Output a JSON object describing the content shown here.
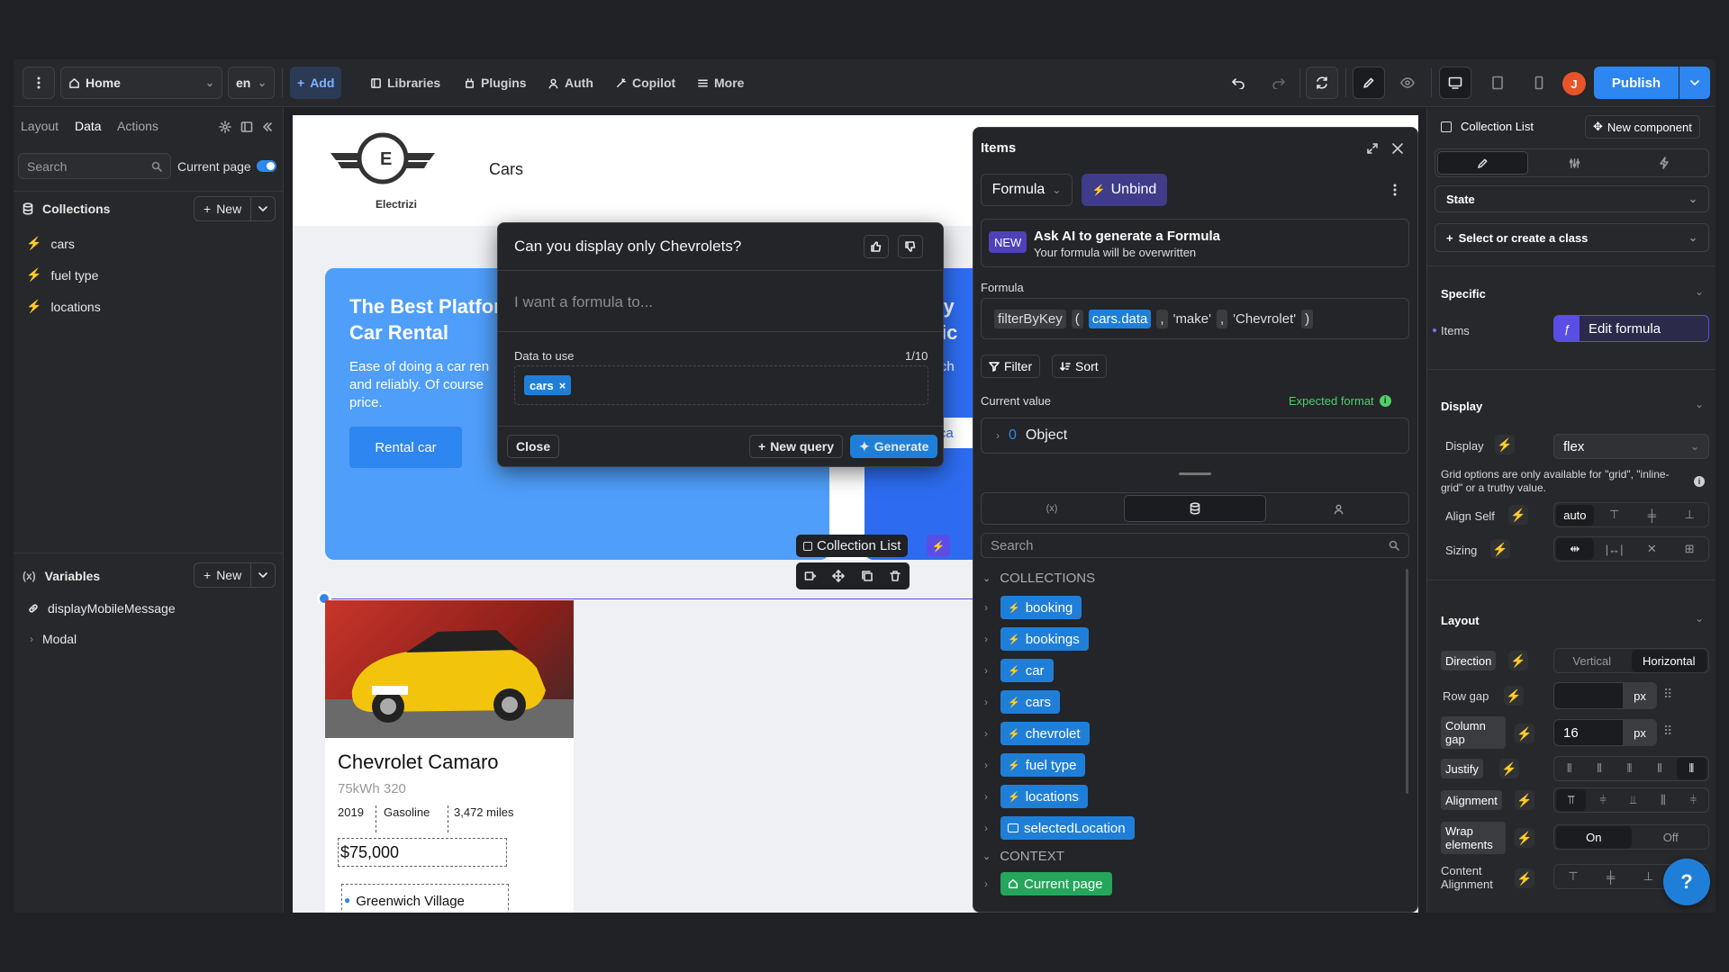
{
  "topbar": {
    "page_select": "Home",
    "lang_select": "en",
    "add": "Add",
    "libraries": "Libraries",
    "plugins": "Plugins",
    "auth": "Auth",
    "copilot": "Copilot",
    "more": "More",
    "avatar_initial": "J",
    "publish": "Publish"
  },
  "left": {
    "tabs": [
      "Layout",
      "Data",
      "Actions"
    ],
    "search_placeholder": "Search",
    "current_page_label": "Current page",
    "collections_title": "Collections",
    "new_label": "New",
    "collections": [
      "cars",
      "fuel type",
      "locations"
    ],
    "variables_title": "Variables",
    "variables": [
      "displayMobileMessage",
      "Modal"
    ]
  },
  "canvas": {
    "logo_letter": "E",
    "logo_text": "Electrizi",
    "page_heading": "Cars",
    "hero_title": "The Best Platfor Car Rental",
    "hero_title_l1": "The Best Platfor",
    "hero_title_l2": "Car Rental",
    "hero_body_l1": "Ease of doing a car ren",
    "hero_body_l2": "and reliably. Of course",
    "hero_body_l3": "price.",
    "hero_button": "Rental car",
    "hero2_l1": "vay",
    "hero2_l2": "oric",
    "hero2_l3": "ng ch",
    "hero2_l4": "and",
    "hero2_btn": "al ca",
    "collection_list_label": "Collection List",
    "card": {
      "title": "Chevrolet Camaro",
      "subtitle": "75kWh 320",
      "year": "2019",
      "fuel": "Gasoline",
      "miles": "3,472 miles",
      "price": "$75,000",
      "location": "Greenwich Village"
    }
  },
  "ai_popup": {
    "question": "Can you display only Chevrolets?",
    "placeholder": "I want a formula to...",
    "data_label": "Data to use",
    "count": "1/10",
    "chip": "cars",
    "close": "Close",
    "new_query": "New query",
    "generate": "Generate"
  },
  "items_panel": {
    "title": "Items",
    "formula_dropdown": "Formula",
    "unbind": "Unbind",
    "new_badge": "NEW",
    "ai_title": "Ask AI to generate a Formula",
    "ai_sub": "Your formula will be overwritten",
    "formula_label": "Formula",
    "formula": {
      "fn": "filterByKey",
      "open": "(",
      "arg1": "cars.data",
      "comma": ",",
      "arg2": "'make'",
      "arg3": "'Chevrolet'",
      "close": ")"
    },
    "filter": "Filter",
    "sort": "Sort",
    "current_value": "Current value",
    "expected_format": "Expected format",
    "value_index": "0",
    "value_type": "Object",
    "search_placeholder": "Search",
    "collections_header": "COLLECTIONS",
    "collections": [
      "booking",
      "bookings",
      "car",
      "cars",
      "chevrolet",
      "fuel type",
      "locations",
      "selectedLocation"
    ],
    "context_header": "CONTEXT",
    "context": [
      "Current page"
    ]
  },
  "right": {
    "element_name": "Collection List",
    "new_component": "New component",
    "state": "State",
    "class_select": "Select or create a class",
    "specific": "Specific",
    "items_label": "Items",
    "edit_formula": "Edit formula",
    "display_section": "Display",
    "display_label": "Display",
    "display_value": "flex",
    "grid_note": "Grid options are only available for \"grid\", \"inline-grid\" or a truthy value.",
    "align_self": "Align Self",
    "align_self_value": "auto",
    "sizing": "Sizing",
    "layout_section": "Layout",
    "direction": "Direction",
    "direction_opts": [
      "Vertical",
      "Horizontal"
    ],
    "row_gap": "Row gap",
    "row_gap_unit": "px",
    "column_gap": "Column gap",
    "column_gap_value": "16",
    "column_gap_unit": "px",
    "justify": "Justify",
    "alignment": "Alignment",
    "wrap": "Wrap elements",
    "wrap_opts": [
      "On",
      "Off"
    ],
    "content_alignment": "Content Alignment"
  },
  "colors": {
    "accent": "#1f7fd8",
    "publish": "#2e86f0",
    "collection_tag": "#1f7fd8",
    "context_tag": "#25a65a",
    "purple": "#5b4ee6"
  }
}
